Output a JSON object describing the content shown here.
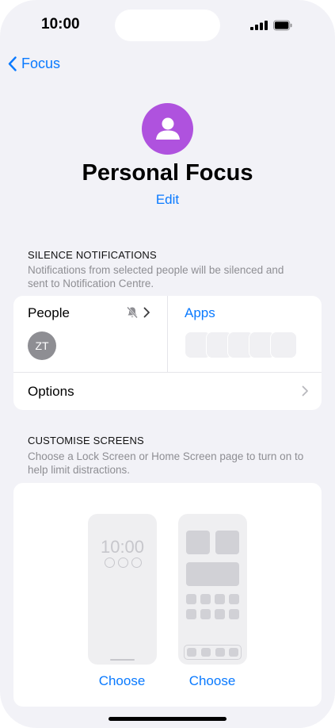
{
  "status_bar": {
    "time": "10:00"
  },
  "nav": {
    "back_label": "Focus"
  },
  "header": {
    "title": "Personal Focus",
    "edit_label": "Edit",
    "accent": "#af52de"
  },
  "silence": {
    "heading": "SILENCE NOTIFICATIONS",
    "description": "Notifications from selected people will be silenced and sent to Notification Centre.",
    "people_label": "People",
    "person_initials": "ZT",
    "apps_label": "Apps",
    "app_slots": 5,
    "options_label": "Options"
  },
  "customise": {
    "heading": "CUSTOMISE SCREENS",
    "description": "Choose a Lock Screen or Home Screen page to turn on to help limit distractions.",
    "lock_time": "10:00",
    "choose_lock_label": "Choose",
    "choose_home_label": "Choose"
  },
  "colors": {
    "link": "#0a7aff",
    "background": "#f2f2f7"
  }
}
